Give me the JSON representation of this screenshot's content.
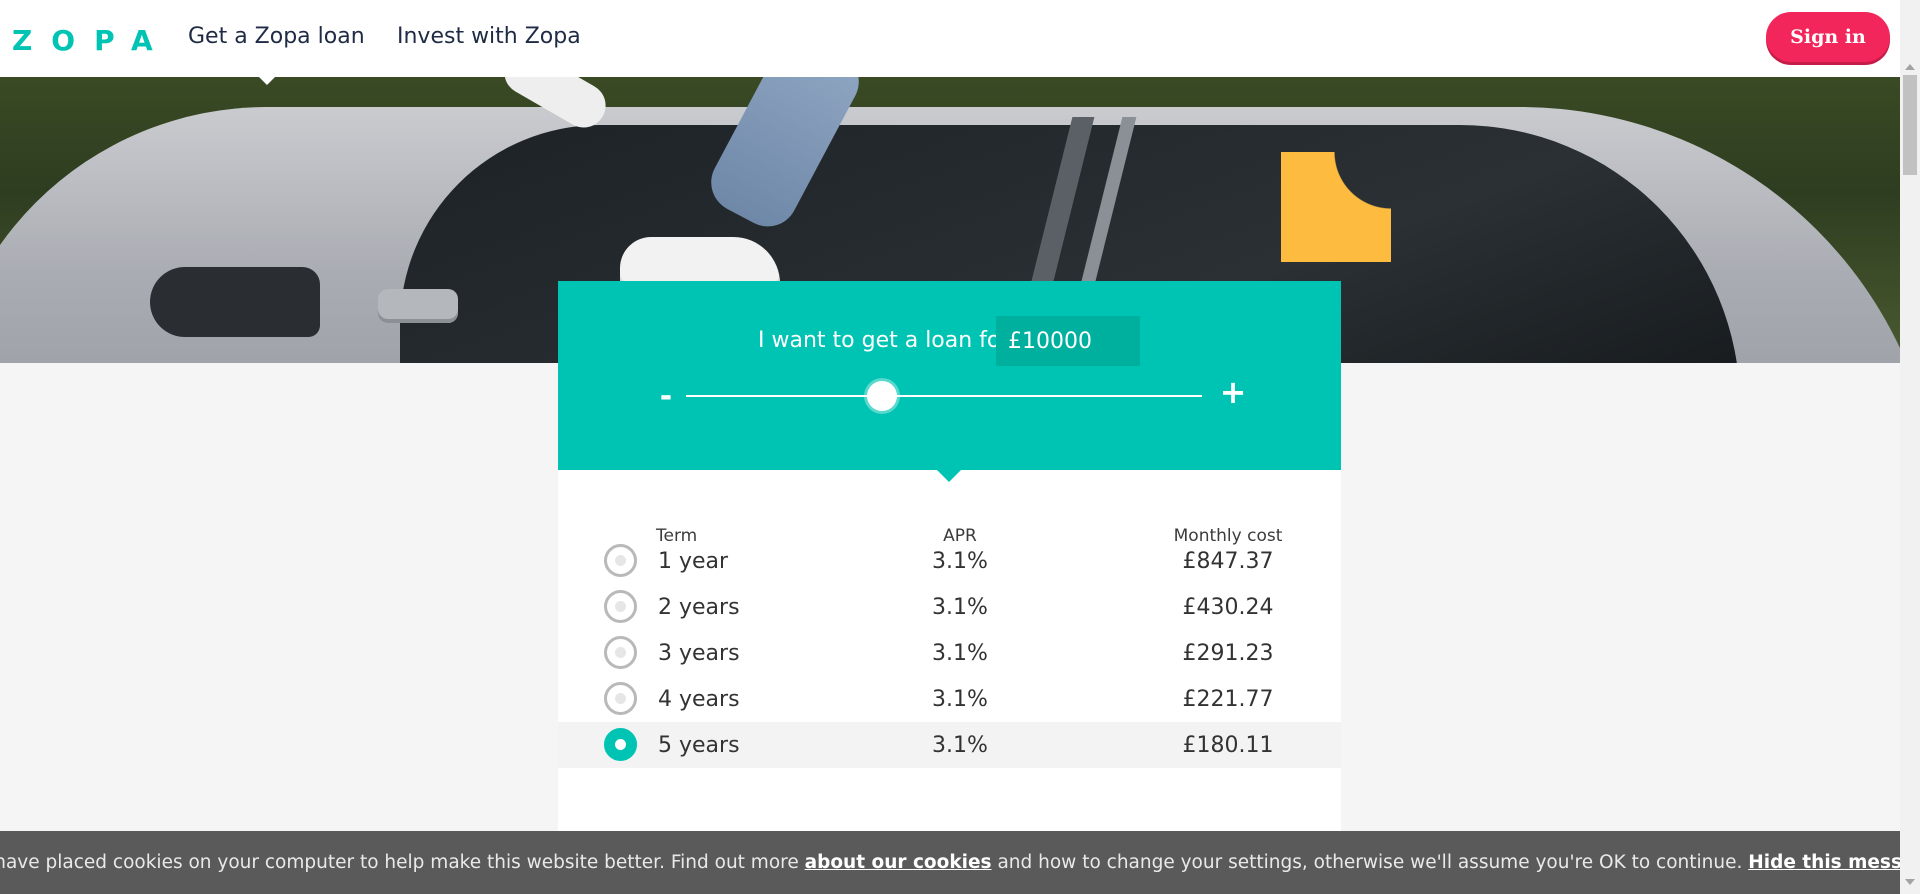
{
  "header": {
    "logo": "ZOPA",
    "nav": [
      {
        "label": "Get a Zopa loan"
      },
      {
        "label": "Invest with Zopa"
      }
    ],
    "signin_label": "Sign in"
  },
  "calculator": {
    "prompt": "I want to get a loan for",
    "amount_value": "£10000",
    "minus_label": "-",
    "plus_label": "+",
    "slider_fraction": 0.38,
    "columns": {
      "term": "Term",
      "apr": "APR",
      "cost": "Monthly cost"
    },
    "rows": [
      {
        "term": "1 year",
        "apr": "3.1%",
        "cost": "£847.37",
        "selected": false
      },
      {
        "term": "2 years",
        "apr": "3.1%",
        "cost": "£430.24",
        "selected": false
      },
      {
        "term": "3 years",
        "apr": "3.1%",
        "cost": "£291.23",
        "selected": false
      },
      {
        "term": "4 years",
        "apr": "3.1%",
        "cost": "£221.77",
        "selected": false
      },
      {
        "term": "5 years",
        "apr": "3.1%",
        "cost": "£180.11",
        "selected": true
      }
    ]
  },
  "cookie_banner": {
    "text_before": "We have placed cookies on your computer to help make this website better. Find out more",
    "link_label": "about our cookies",
    "text_after": "and how to change your settings, otherwise we'll assume you're OK to continue.",
    "hide_label": "Hide this message"
  },
  "colors": {
    "brand": "#00c4b3",
    "signin": "#f3265b",
    "accent_yellow": "#fdbb3f"
  }
}
